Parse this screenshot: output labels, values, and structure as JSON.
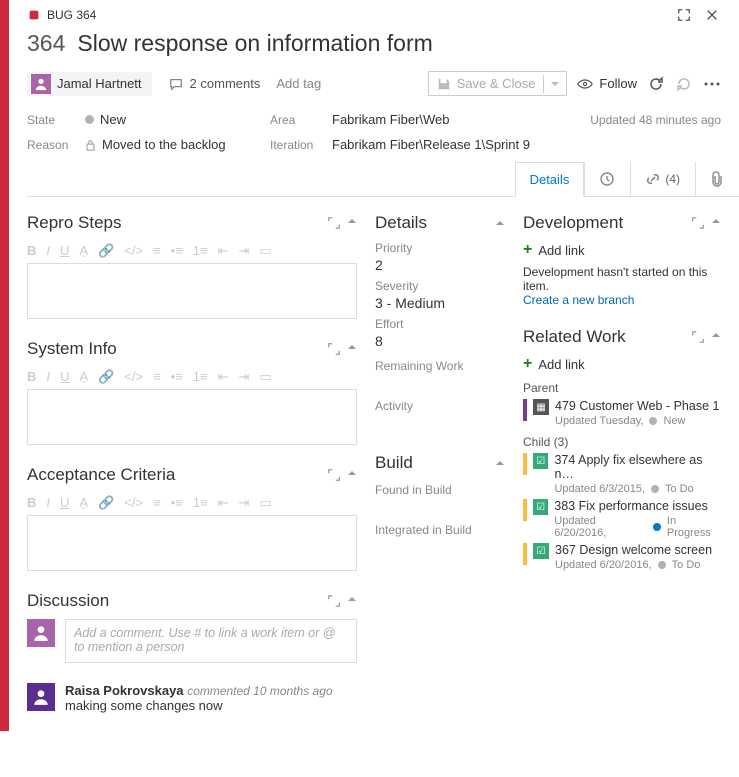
{
  "window": {
    "type_id": "BUG 364",
    "id": "364",
    "title": "Slow response on information form"
  },
  "header": {
    "assignee": "Jamal Hartnett",
    "comments": "2 comments",
    "add_tag": "Add tag",
    "save_close": "Save & Close",
    "follow": "Follow"
  },
  "meta": {
    "state_label": "State",
    "state": "New",
    "area_label": "Area",
    "area": "Fabrikam Fiber\\Web",
    "reason_label": "Reason",
    "reason": "Moved to the backlog",
    "iteration_label": "Iteration",
    "iteration": "Fabrikam Fiber\\Release 1\\Sprint 9",
    "updated": "Updated 48 minutes ago"
  },
  "tabs": {
    "details": "Details",
    "links_count": "(4)"
  },
  "left": {
    "repro": "Repro Steps",
    "system_info": "System Info",
    "acceptance": "Acceptance Criteria",
    "discussion": "Discussion",
    "comment_placeholder": "Add a comment. Use # to link a work item or @ to mention a person",
    "past_commenter": "Raisa Pokrovskaya",
    "past_meta": "commented 10 months ago",
    "past_text": "making some changes now"
  },
  "mid": {
    "details": "Details",
    "priority_lbl": "Priority",
    "priority": "2",
    "severity_lbl": "Severity",
    "severity": "3 - Medium",
    "effort_lbl": "Effort",
    "effort": "8",
    "remaining_lbl": "Remaining Work",
    "activity_lbl": "Activity",
    "build": "Build",
    "found_in": "Found in Build",
    "integrated_in": "Integrated in Build"
  },
  "right": {
    "development": "Development",
    "add_link": "Add link",
    "dev_msg": "Development hasn't started on this item.",
    "create_branch": "Create a new branch",
    "related": "Related Work",
    "parent_lbl": "Parent",
    "parent": {
      "id": "479",
      "title": "Customer Web - Phase 1",
      "sub": "Updated Tuesday,",
      "state": "New"
    },
    "child_lbl": "Child (3)",
    "children": [
      {
        "id": "374",
        "title": "Apply fix elsewhere as n…",
        "sub": "Updated 6/3/2015,",
        "state": "To Do",
        "dot": "gray"
      },
      {
        "id": "383",
        "title": "Fix performance issues",
        "sub": "Updated 6/20/2016,",
        "state": "In Progress",
        "dot": "blue"
      },
      {
        "id": "367",
        "title": "Design welcome screen",
        "sub": "Updated 6/20/2016,",
        "state": "To Do",
        "dot": "gray"
      }
    ]
  }
}
